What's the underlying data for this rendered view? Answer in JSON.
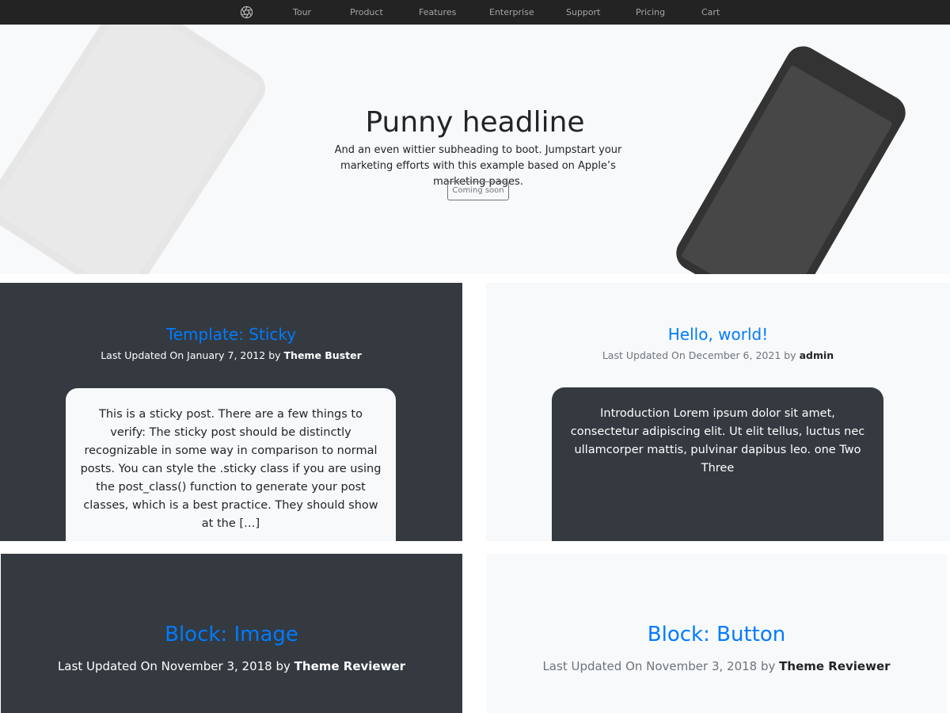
{
  "navbar": {
    "logo_icon": "aperture-icon",
    "links": [
      "Tour",
      "Product",
      "Features",
      "Enterprise",
      "Support",
      "Pricing",
      "Cart"
    ]
  },
  "hero": {
    "title": "Punny headline",
    "subtitle": "And an even wittier subheading to boot. Jumpstart your marketing efforts with this example based on Apple’s marketing pages.",
    "button_label": "Coming soon"
  },
  "posts": [
    {
      "title": "Template: Sticky",
      "meta_prefix": "Last Updated On January 7, 2012 by",
      "author": "Theme Buster",
      "excerpt": "This is a sticky post. There are a few things to verify: The sticky post should be distinctly recognizable in some way in comparison to normal posts. You can style the .sticky class if you are using the post_class() function to generate your post classes, which is a best practice. They should show at the […]"
    },
    {
      "title": "Hello, world!",
      "meta_prefix": "Last Updated On December 6, 2021 by",
      "author": "admin",
      "excerpt": "Introduction Lorem ipsum dolor sit amet, consectetur adipiscing elit. Ut elit tellus, luctus nec ullamcorper mattis, pulvinar dapibus leo. one Two Three"
    },
    {
      "title": "Block: Image",
      "meta_prefix": "Last Updated On November 3, 2018 by",
      "author": "Theme Reviewer"
    },
    {
      "title": "Block: Button",
      "meta_prefix": "Last Updated On November 3, 2018 by",
      "author": "Theme Reviewer"
    }
  ],
  "colors": {
    "navbar_bg": "#232323",
    "link_blue": "#007bff",
    "dark_card": "#343a40",
    "light_card": "#f8f9fa"
  }
}
